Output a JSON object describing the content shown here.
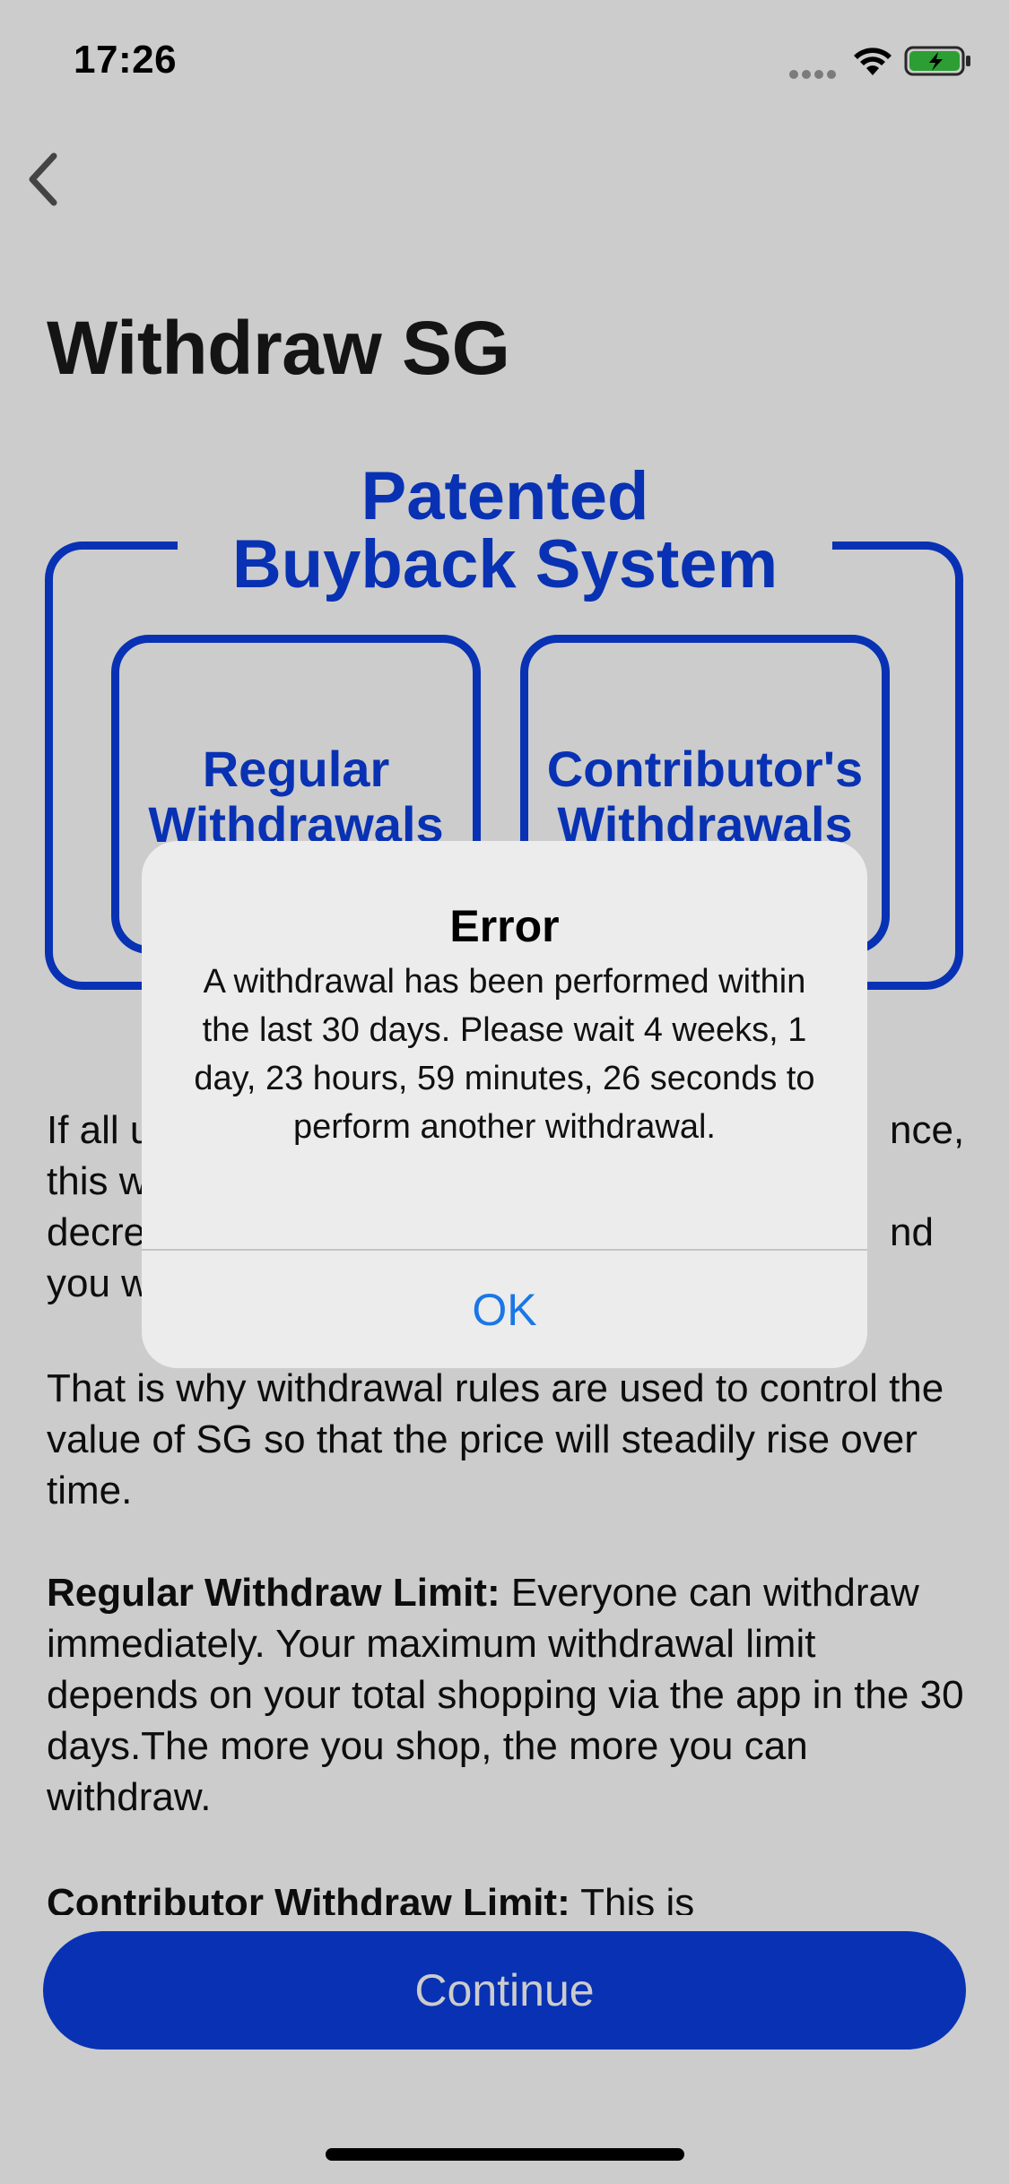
{
  "status_bar": {
    "time": "17:26"
  },
  "nav": {
    "back_icon": "chevron-left-icon"
  },
  "page": {
    "title": "Withdraw SG"
  },
  "infographic": {
    "title_line1": "Patented",
    "title_line2": "Buyback System",
    "left_box_line1": "Regular",
    "left_box_line2": "Withdrawals",
    "right_box_line1": "Contributor's",
    "right_box_line2": "Withdrawals"
  },
  "body": {
    "p1_line1": "If all u",
    "p1_line1_end": "nce,",
    "p1_line2": "this w",
    "p1_line3": "decre",
    "p1_line3_end": "nd",
    "p1_line4": "you w",
    "p2": "That is why withdrawal rules are used to control the value of SG so that the price will steadily rise over time.",
    "p3_bold": "Regular Withdraw Limit:",
    "p3_rest": " Everyone can withdraw immediately. Your maximum withdrawal limit depends on your total shopping via the app in the 30 days.The more you shop, the more you can withdraw.",
    "p4_bold": "Contributor Withdraw Limit:",
    "p4_rest": " This is"
  },
  "continue": {
    "label": "Continue"
  },
  "alert": {
    "title": "Error",
    "message": "A withdrawal has been performed within the last 30 days. Please wait 4 weeks, 1 day, 23 hours, 59 minutes, 26 seconds to perform another withdrawal.",
    "ok_label": "OK"
  },
  "colors": {
    "brand_blue": "#0a3fe0",
    "alert_button": "#1a77e6"
  }
}
